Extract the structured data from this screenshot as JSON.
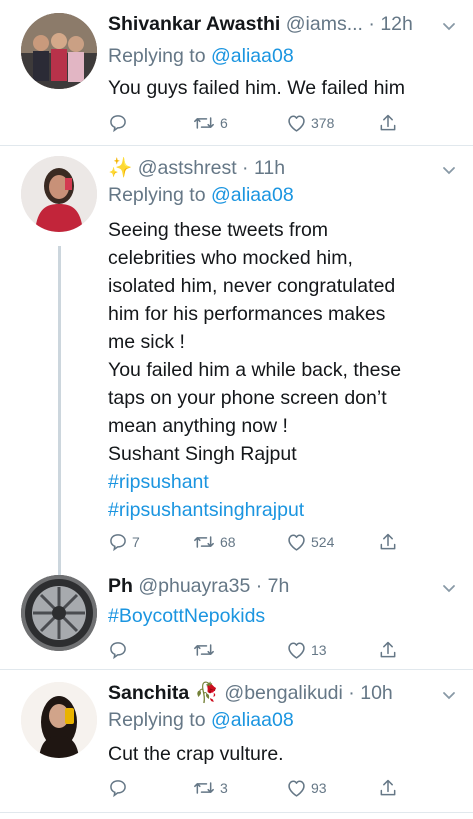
{
  "tweets": [
    {
      "name": "Shivankar Awasthi",
      "handle": "@iams...",
      "time": "12h",
      "reply_label": "Replying to",
      "reply_to": "@aliaa08",
      "lines": [
        "You guys failed him. We failed him"
      ],
      "counts": {
        "reply": "",
        "retweet": "6",
        "like": "378"
      }
    },
    {
      "name": "",
      "name_emoji": "✨",
      "handle": "@astshrest",
      "time": "11h",
      "reply_label": "Replying to",
      "reply_to": "@aliaa08",
      "lines": [
        "Seeing these tweets from",
        "celebrities who mocked him,",
        "isolated him, never congratulated",
        "him for his performances makes",
        "me sick  !",
        "You failed him a while back, these",
        "taps on your phone screen don’t",
        "mean anything now !",
        "Sushant Singh Rajput",
        "#ripsushant",
        "#ripsushantsinghrajput"
      ],
      "counts": {
        "reply": "7",
        "retweet": "68",
        "like": "524"
      }
    },
    {
      "name": "Ph",
      "handle": "@phuayra35",
      "time": "7h",
      "lines": [
        "#BoycottNepokids"
      ],
      "counts": {
        "reply": "",
        "retweet": "",
        "like": "13"
      }
    },
    {
      "name": "Sanchita",
      "name_emoji": "🥀",
      "handle": "@bengalikudi",
      "time": "10h",
      "reply_label": "Replying to",
      "reply_to": "@aliaa08",
      "lines": [
        "Cut the crap vulture."
      ],
      "counts": {
        "reply": "",
        "retweet": "3",
        "like": "93"
      }
    }
  ],
  "icons": {
    "reply": "reply-icon",
    "retweet": "retweet-icon",
    "like": "heart-icon",
    "share": "share-icon",
    "more": "chevron-down-icon"
  },
  "colors": {
    "link": "#1b95e0",
    "muted": "#657786",
    "text": "#14171a",
    "divider": "#e1e8ed"
  }
}
